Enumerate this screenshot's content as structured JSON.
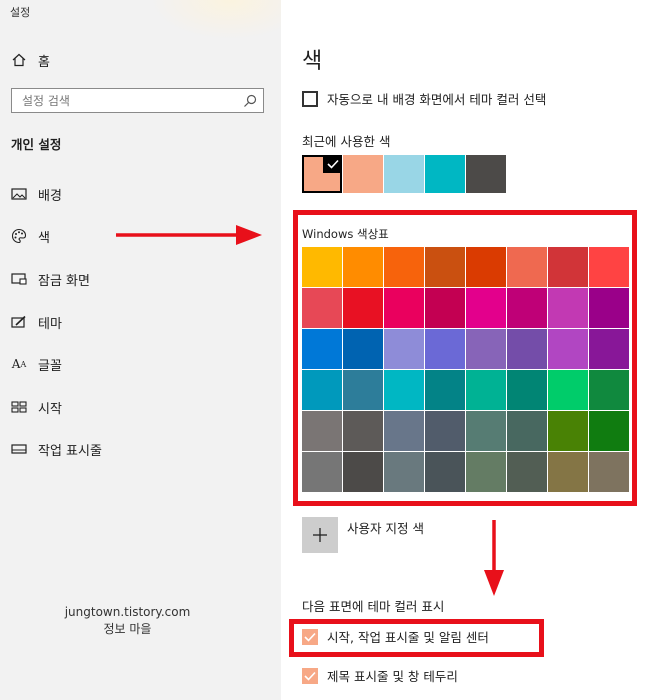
{
  "sidebar": {
    "app_title": "설정",
    "home": "홈",
    "search_placeholder": "설정 검색",
    "section_title": "개인 설정",
    "items": [
      {
        "label": "배경",
        "icon": "picture-icon"
      },
      {
        "label": "색",
        "icon": "palette-icon"
      },
      {
        "label": "잠금 화면",
        "icon": "lock-screen-icon"
      },
      {
        "label": "테마",
        "icon": "theme-brush-icon"
      },
      {
        "label": "글꼴",
        "icon": "font-icon"
      },
      {
        "label": "시작",
        "icon": "start-icon"
      },
      {
        "label": "작업 표시줄",
        "icon": "taskbar-icon"
      }
    ],
    "watermark_line1": "jungtown.tistory.com",
    "watermark_line2": "정보 마을"
  },
  "main": {
    "title": "색",
    "auto_pick_label": "자동으로 내 배경 화면에서 테마 컬러 선택",
    "recent_label": "최근에 사용한 색",
    "recent_colors": [
      "#f7a886",
      "#f7a886",
      "#99d6e6",
      "#00b7c3",
      "#4c4a48"
    ],
    "palette_label": "Windows 색상표",
    "palette": [
      [
        "#ffb900",
        "#ff8c00",
        "#f7630c",
        "#ca5010",
        "#da3b01",
        "#ef6950",
        "#d13438",
        "#ff4343"
      ],
      [
        "#e74856",
        "#e81123",
        "#ea005e",
        "#c30052",
        "#e3008c",
        "#bf0077",
        "#c239b3",
        "#9a0089"
      ],
      [
        "#0078d7",
        "#0063b1",
        "#8e8cd8",
        "#6b69d6",
        "#8764b8",
        "#744da9",
        "#b146c2",
        "#881798"
      ],
      [
        "#0099bc",
        "#2d7d9a",
        "#00b7c3",
        "#038387",
        "#00b294",
        "#018574",
        "#00cc6a",
        "#10893e"
      ],
      [
        "#7a7574",
        "#5d5a58",
        "#68768a",
        "#515c6b",
        "#567c73",
        "#486860",
        "#498205",
        "#107c10"
      ],
      [
        "#767676",
        "#4c4a48",
        "#69797e",
        "#4a5459",
        "#647c64",
        "#525e54",
        "#847545",
        "#7e735f"
      ]
    ],
    "custom_color_label": "사용자 지정 색",
    "show_accent_label": "다음 표면에 테마 컬러 표시",
    "surfaces": [
      {
        "label": "시작, 작업 표시줄 및 알림 센터",
        "checked": true
      },
      {
        "label": "제목 표시줄 및 창 테두리",
        "checked": true
      }
    ]
  },
  "colors": {
    "annotation_red": "#e8101a",
    "sidebar_bg": "#f2f2f2",
    "accent_checkbox": "#f7a886"
  }
}
